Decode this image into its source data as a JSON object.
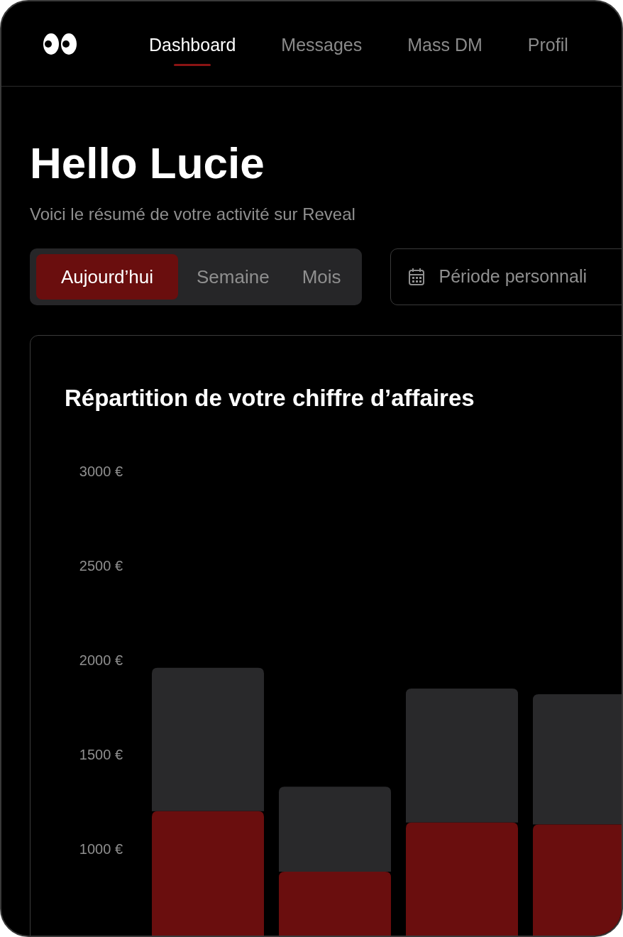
{
  "nav": {
    "tabs": [
      {
        "label": "Dashboard",
        "selected": true
      },
      {
        "label": "Messages",
        "selected": false
      },
      {
        "label": "Mass DM",
        "selected": false
      },
      {
        "label": "Profil",
        "selected": false
      }
    ]
  },
  "greeting": {
    "title": "Hello Lucie",
    "subtitle": "Voici le résumé de votre activité sur Reveal"
  },
  "period": {
    "options": [
      {
        "label": "Aujourd’hui",
        "selected": true
      },
      {
        "label": "Semaine",
        "selected": false
      },
      {
        "label": "Mois",
        "selected": false
      }
    ],
    "custom_button": "Période personnali"
  },
  "revenue_card": {
    "title": "Répartition de votre chiffre d’affaires",
    "chart_data": {
      "type": "bar",
      "stacked": true,
      "orientation": "vertical",
      "ylim": [
        0,
        3000
      ],
      "yticks": [
        {
          "value": 1000,
          "label": "1000 €"
        },
        {
          "value": 1500,
          "label": "1500 €"
        },
        {
          "value": 2000,
          "label": "2000 €"
        },
        {
          "value": 2500,
          "label": "2500 €"
        },
        {
          "value": 3000,
          "label": "3000 €"
        }
      ],
      "series": [
        {
          "color": "#6a0e0e",
          "values": [
            1200,
            880,
            1140,
            1130
          ]
        },
        {
          "color": "#29292b",
          "values": [
            760,
            450,
            710,
            690
          ]
        }
      ]
    }
  }
}
